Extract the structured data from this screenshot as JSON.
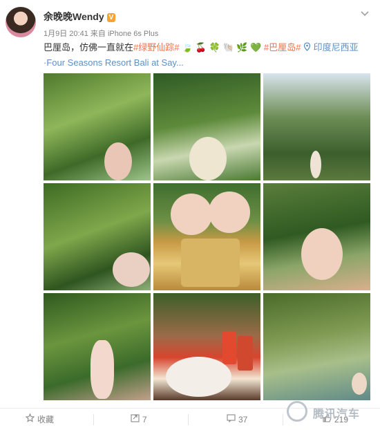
{
  "post": {
    "author": "余晚晚Wendy",
    "badge": "vip-icon",
    "time": "1月9日 20:41",
    "source_prefix": "来自",
    "source": "iPhone 6s Plus",
    "text_intro": "巴厘岛，仿佛一直就在",
    "hashtag1": "#绿野仙踪#",
    "emoji_seq": "🍃 🍒 🍀 🐚 🌿 💚",
    "hashtag2": "#巴厘岛#",
    "location_icon": "location-pin-icon",
    "location": "印度尼西亚·Four Seasons Resort Bali at Say..."
  },
  "photos": [
    {
      "icon": "photo-1"
    },
    {
      "icon": "photo-2"
    },
    {
      "icon": "photo-3"
    },
    {
      "icon": "photo-4"
    },
    {
      "icon": "photo-5"
    },
    {
      "icon": "photo-6"
    },
    {
      "icon": "photo-7"
    },
    {
      "icon": "photo-8"
    },
    {
      "icon": "photo-9"
    }
  ],
  "footer": {
    "favorite_label": "收藏",
    "repost_count": "7",
    "comment_count": "37",
    "like_count": "219"
  },
  "watermark": "腾讯汽车",
  "colors": {
    "link": "#eb7350",
    "location": "#5d8fc4",
    "muted": "#808080"
  }
}
